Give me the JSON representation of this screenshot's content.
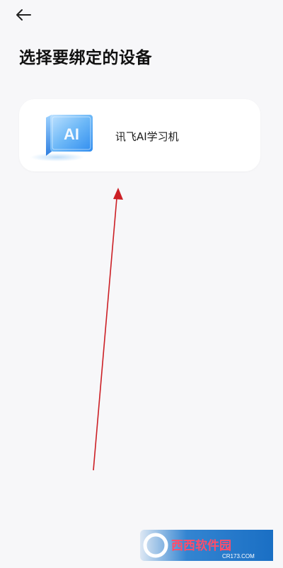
{
  "header": {
    "back_icon": "arrow-left-icon"
  },
  "page": {
    "title": "选择要绑定的设备"
  },
  "devices": [
    {
      "name": "讯飞AI学习机",
      "icon": "ai-device-icon",
      "icon_text": "AI"
    }
  ],
  "watermark": {
    "text": "西西软件园",
    "subtext": "CR173.COM"
  },
  "colors": {
    "background": "#f7f7f9",
    "card": "#ffffff",
    "annotation_arrow": "#cc1f25",
    "icon_blue": "#3f9cf2"
  }
}
